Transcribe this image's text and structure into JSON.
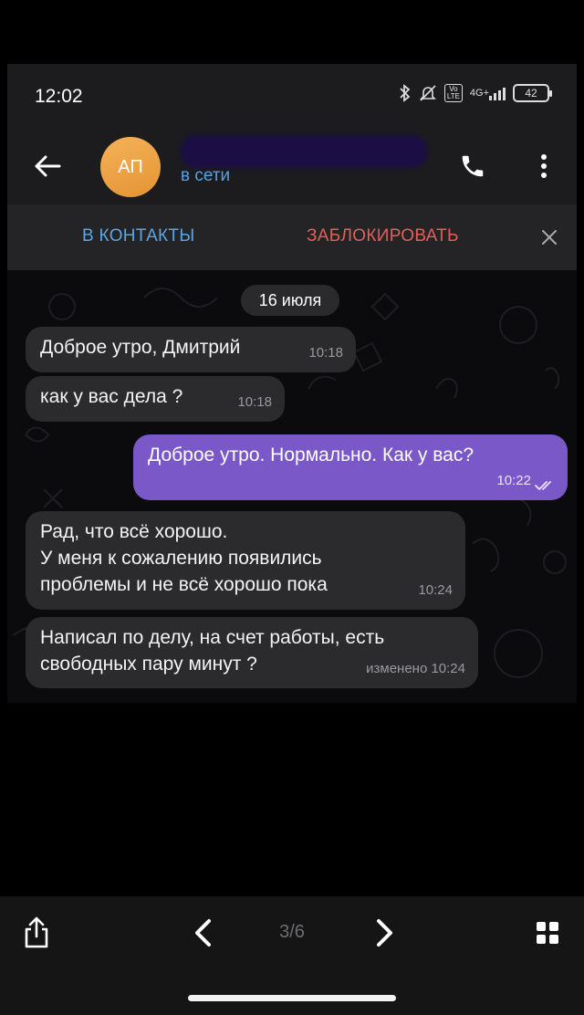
{
  "status_bar": {
    "time": "12:02",
    "network": "4G+",
    "volte": "Vo LTE",
    "battery": "42"
  },
  "chat_header": {
    "avatar_initials": "АП",
    "status": "в сети"
  },
  "action_bar": {
    "add_contact": "В КОНТАКТЫ",
    "block": "ЗАБЛОКИРОВАТЬ"
  },
  "date_chip": "16 июля",
  "messages": [
    {
      "direction": "in",
      "text": "Доброе утро, Дмитрий",
      "time": "10:18"
    },
    {
      "direction": "in",
      "text": "как у вас дела ?",
      "time": "10:18"
    },
    {
      "direction": "out",
      "text": "Доброе утро. Нормально. Как у вас?",
      "time": "10:22"
    },
    {
      "direction": "in",
      "lines": [
        "Рад, что всё хорошо.",
        "У меня к сожалению появились",
        "проблемы и не всё хорошо пока"
      ],
      "time": "10:24"
    },
    {
      "direction": "in",
      "lines": [
        "Написал по делу, на счет работы, есть",
        "свободных пару минут ?"
      ],
      "time": "изменено 10:24"
    }
  ],
  "viewer_bar": {
    "page_counter": "3/6"
  },
  "colors": {
    "accent_blue": "#5aa6e8",
    "danger_red": "#e35f5a",
    "outgoing_bubble": "#7a58c8",
    "avatar_orange": "#f0a545"
  }
}
